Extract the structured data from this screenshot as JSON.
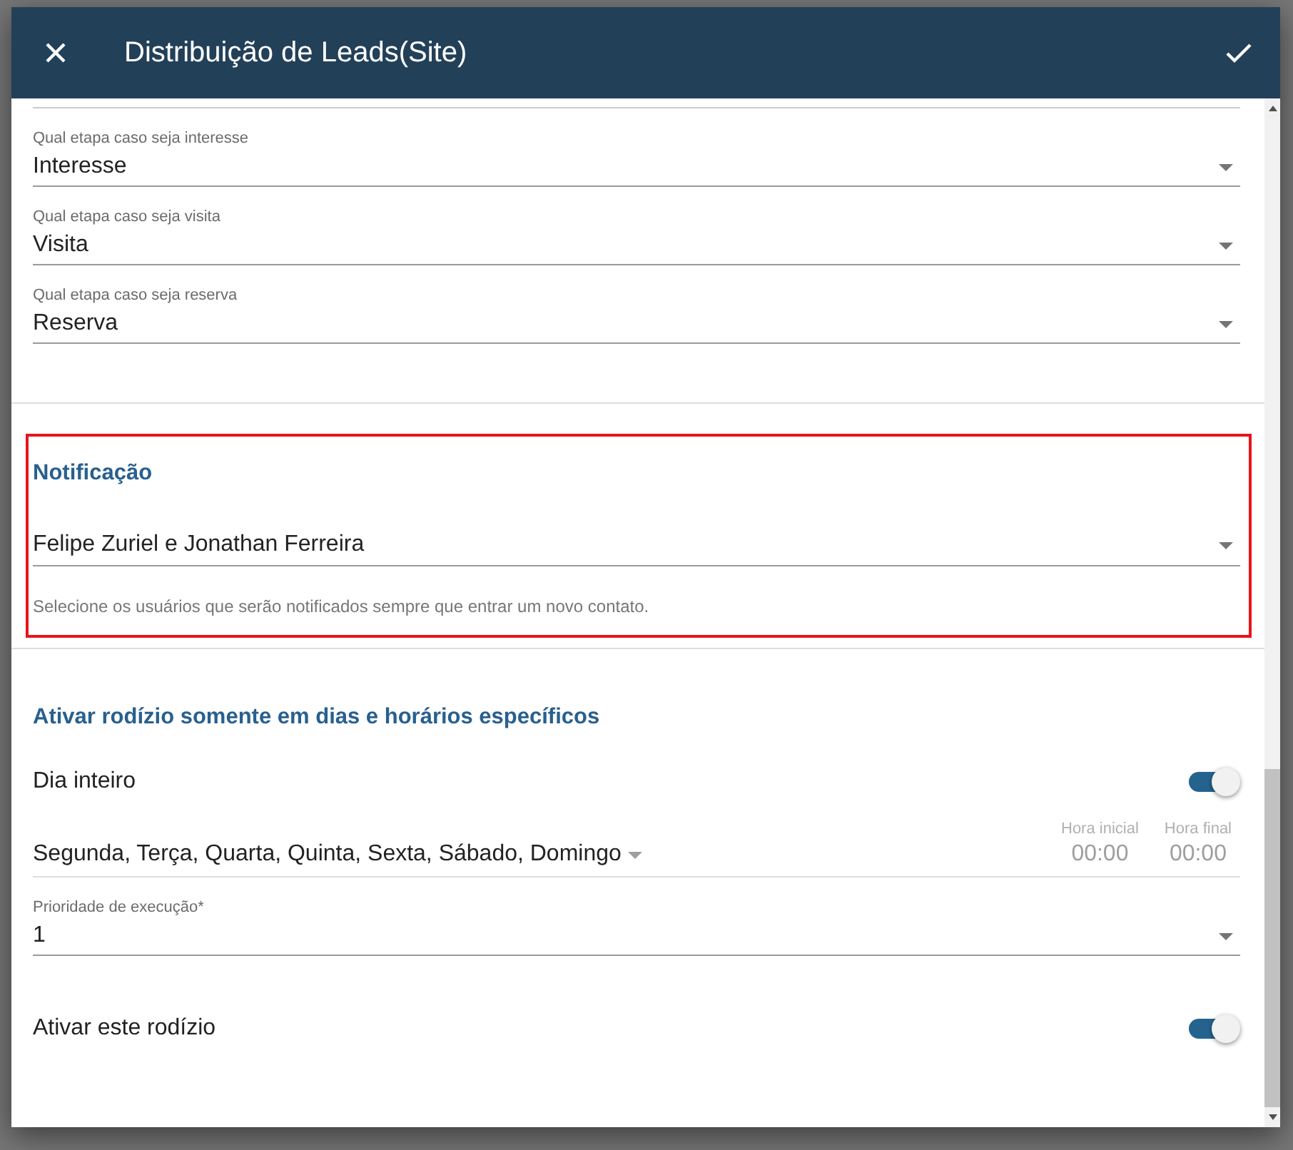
{
  "dialog": {
    "title": "Distribuição de Leads(Site)"
  },
  "stage_fields": [
    {
      "label": "Qual etapa caso seja interesse",
      "value": "Interesse"
    },
    {
      "label": "Qual etapa caso seja visita",
      "value": "Visita"
    },
    {
      "label": "Qual etapa caso seja reserva",
      "value": "Reserva"
    }
  ],
  "notification": {
    "title": "Notificação",
    "highlighted": true,
    "value": "Felipe Zuriel e Jonathan Ferreira",
    "helper": "Selecione os usuários que serão notificados sempre que entrar um novo contato."
  },
  "schedule": {
    "title": "Ativar rodízio somente em dias e horários específicos",
    "full_day": {
      "label": "Dia inteiro",
      "on": true
    },
    "days": "Segunda, Terça, Quarta, Quinta, Sexta, Sábado, Domingo",
    "start": {
      "label": "Hora inicial",
      "value": "00:00",
      "disabled": true
    },
    "end": {
      "label": "Hora final",
      "value": "00:00",
      "disabled": true
    },
    "priority": {
      "label": "Prioridade de execução*",
      "value": "1"
    }
  },
  "activate": {
    "label": "Ativar este rodízio",
    "on": true
  }
}
